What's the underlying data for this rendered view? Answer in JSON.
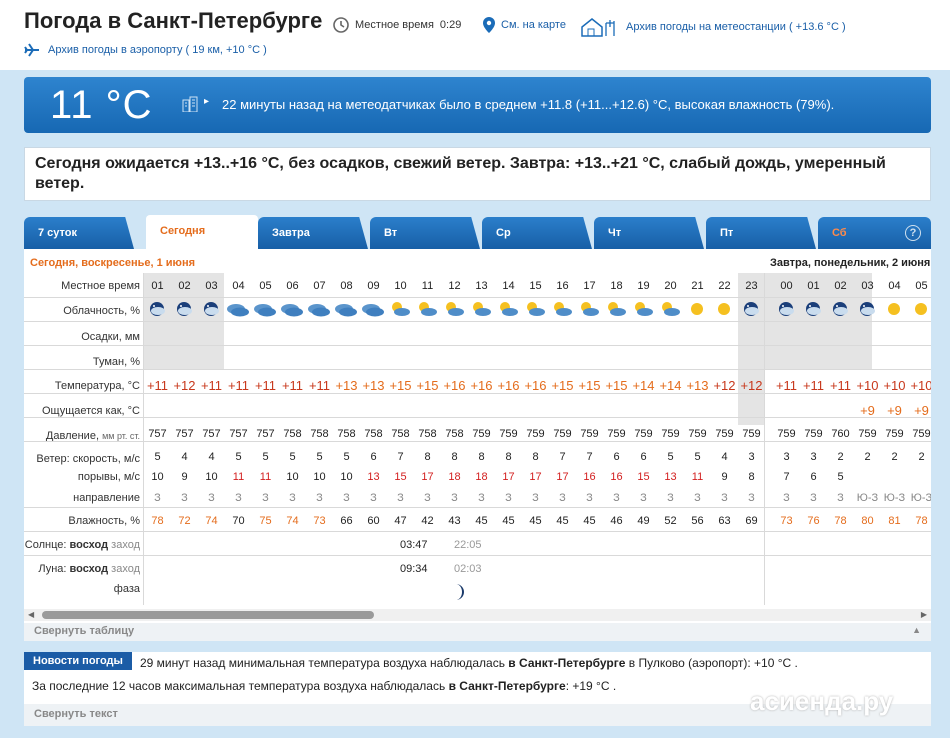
{
  "header": {
    "title": "Погода в Санкт-Петербурге",
    "local_time_label": "Местное время",
    "local_time": "0:29",
    "map_link": "См. на карте",
    "station_archive": "Архив погоды на метеостанции ( +13.6 °C )",
    "airport_archive": "Архив погоды в аэропорту ( 19 км, +10 °C )"
  },
  "current": {
    "temp": "11 °C",
    "observation": "22 минуты назад на метеодатчиках было в среднем +11.8 (+11...+12.6) °C, высокая влажность (79%)."
  },
  "forecast_text": "Сегодня ожидается +13..+16 °C, без осадков, свежий ветер. Завтра: +13..+21 °C, слабый дождь, умеренный ветер.",
  "tabs": [
    {
      "label": "7 суток"
    },
    {
      "label": "Сегодня"
    },
    {
      "label": "Завтра"
    },
    {
      "label": "Вт"
    },
    {
      "label": "Ср"
    },
    {
      "label": "Чт"
    },
    {
      "label": "Пт"
    },
    {
      "label": "Сб"
    }
  ],
  "help_label": "?",
  "table": {
    "date_today": "Сегодня, воскресенье, 1 июня",
    "date_tomorrow": "Завтра, понедельник, 2 июня",
    "row_labels": {
      "time": "Местное время",
      "clouds": "Облачность, %",
      "precip": "Осадки, мм",
      "fog": "Туман, %",
      "temp": "Температура, °C",
      "feels": "Ощущается как, °C",
      "pressure_label": "Давление,",
      "pressure_unit": "мм рт. ст.",
      "wind_label": "Ветер: скорость, м/с",
      "gust_label": "порывы, м/с",
      "dir_label": "направление",
      "humidity": "Влажность, %",
      "sun_prefix": "Солнце:",
      "sun_rise": "восход",
      "sun_set": "заход",
      "moon_prefix": "Луна:",
      "moon_rise": "восход",
      "moon_set": "заход",
      "moon_phase": "фаза"
    },
    "hours": [
      "01",
      "02",
      "03",
      "04",
      "05",
      "06",
      "07",
      "08",
      "09",
      "10",
      "11",
      "12",
      "13",
      "14",
      "15",
      "16",
      "17",
      "18",
      "19",
      "20",
      "21",
      "22",
      "23",
      "00",
      "01",
      "02",
      "03",
      "04",
      "05"
    ],
    "clouds_icons": [
      "night-cloud",
      "night-cloud",
      "night-cloud",
      "overcast",
      "overcast",
      "overcast",
      "overcast",
      "overcast",
      "overcast",
      "sun-cloud",
      "sun-cloud",
      "sun-cloud",
      "sun-cloud",
      "sun-cloud",
      "sun-cloud",
      "sun-cloud",
      "sun-cloud",
      "sun-cloud",
      "sun-cloud",
      "sun-cloud",
      "sun",
      "sun",
      "night-cloud",
      "night-cloud",
      "night-cloud",
      "night-cloud",
      "night-cloud",
      "sun",
      "sun"
    ],
    "temps": [
      "+11",
      "+12",
      "+11",
      "+11",
      "+11",
      "+11",
      "+11",
      "+13",
      "+13",
      "+15",
      "+15",
      "+16",
      "+16",
      "+16",
      "+16",
      "+15",
      "+15",
      "+15",
      "+14",
      "+14",
      "+13",
      "+12",
      "+12",
      "+11",
      "+11",
      "+11",
      "+10",
      "+10",
      "+10"
    ],
    "feels": [
      "",
      "",
      "",
      "",
      "",
      "",
      "",
      "",
      "",
      "",
      "",
      "",
      "",
      "",
      "",
      "",
      "",
      "",
      "",
      "",
      "",
      "",
      "",
      "",
      "",
      "",
      "+9",
      "+9",
      "+9"
    ],
    "pressure": [
      "757",
      "757",
      "757",
      "757",
      "757",
      "758",
      "758",
      "758",
      "758",
      "758",
      "758",
      "758",
      "759",
      "759",
      "759",
      "759",
      "759",
      "759",
      "759",
      "759",
      "759",
      "759",
      "759",
      "759",
      "759",
      "760",
      "759",
      "759",
      "759"
    ],
    "wind": [
      "5",
      "4",
      "4",
      "5",
      "5",
      "5",
      "5",
      "5",
      "6",
      "7",
      "8",
      "8",
      "8",
      "8",
      "8",
      "7",
      "7",
      "6",
      "6",
      "5",
      "5",
      "4",
      "3",
      "3",
      "3",
      "2",
      "2",
      "2",
      "2"
    ],
    "gusts": [
      "10",
      "9",
      "10",
      "11",
      "11",
      "10",
      "10",
      "10",
      "13",
      "15",
      "17",
      "18",
      "18",
      "17",
      "17",
      "17",
      "16",
      "16",
      "15",
      "13",
      "11",
      "9",
      "8",
      "7",
      "6",
      "5",
      "",
      "",
      ""
    ],
    "direction": [
      "З",
      "З",
      "З",
      "З",
      "З",
      "З",
      "З",
      "З",
      "З",
      "З",
      "З",
      "З",
      "З",
      "З",
      "З",
      "З",
      "З",
      "З",
      "З",
      "З",
      "З",
      "З",
      "З",
      "З",
      "З",
      "З",
      "Ю-З",
      "Ю-З",
      "Ю-З"
    ],
    "humidity": [
      "78",
      "72",
      "74",
      "70",
      "75",
      "74",
      "73",
      "66",
      "60",
      "47",
      "42",
      "43",
      "45",
      "45",
      "45",
      "45",
      "45",
      "46",
      "49",
      "52",
      "56",
      "63",
      "69",
      "73",
      "76",
      "78",
      "80",
      "81",
      "78"
    ],
    "sunrise": "03:47",
    "sunset": "22:05",
    "moonrise": "09:34",
    "moonset": "02:03",
    "collapse_label": "Свернуть таблицу"
  },
  "news": {
    "badge": "Новости погоды",
    "line1_prefix": "29 минут назад минимальная температура воздуха наблюдалась",
    "line1_city": "в Санкт-Петербурге",
    "line1_suffix": "в Пулково (аэропорт): +10 °C .",
    "line2_prefix": "За последние 12 часов максимальная температура воздуха наблюдалась",
    "line2_city": "в Санкт-Петербурге",
    "line2_suffix": ": +19 °C .",
    "collapse_label": "Свернуть текст"
  },
  "watermark": "асиенда.ру",
  "colors": {
    "accent": "#1b6cb8",
    "orange": "#e46c1c",
    "red": "#d32020"
  }
}
